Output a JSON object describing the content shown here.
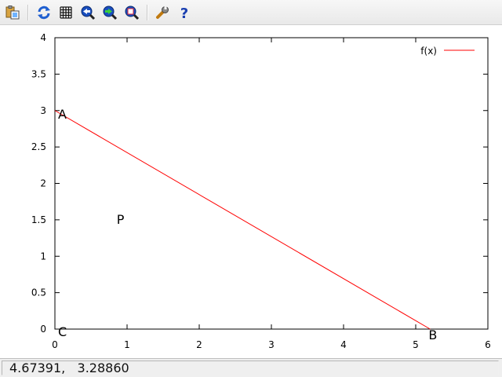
{
  "toolbar": {
    "buttons": [
      {
        "name": "copy-to-clipboard-icon"
      },
      {
        "name": "replot-icon"
      },
      {
        "name": "grid-icon"
      },
      {
        "name": "zoom-previous-icon"
      },
      {
        "name": "zoom-next-icon"
      },
      {
        "name": "unzoom-icon"
      },
      {
        "name": "preferences-wrench-icon"
      },
      {
        "name": "help-icon"
      }
    ]
  },
  "chart_data": {
    "type": "line",
    "xlim": [
      0,
      6
    ],
    "ylim": [
      0,
      4
    ],
    "x_ticks": [
      "0",
      "1",
      "2",
      "3",
      "4",
      "5",
      "6"
    ],
    "y_ticks": [
      "0",
      "0.5",
      "1",
      "1.5",
      "2",
      "2.5",
      "3",
      "3.5",
      "4"
    ],
    "series": [
      {
        "name": "f(x)",
        "color": "#ff0000",
        "x": [
          0,
          5.2
        ],
        "y": [
          3,
          0
        ]
      }
    ],
    "legend": {
      "position": "top-right",
      "label": "f(x)"
    },
    "annotations": [
      {
        "text": "A",
        "x": 0,
        "y": 3
      },
      {
        "text": "B",
        "x": 5.2,
        "y": 0
      },
      {
        "text": "C",
        "x": 0,
        "y": 0
      },
      {
        "text": "P",
        "x": 0.9,
        "y": 1.5
      }
    ],
    "grid": false
  },
  "status": {
    "coordinates": "4.67391,   3.28860"
  }
}
